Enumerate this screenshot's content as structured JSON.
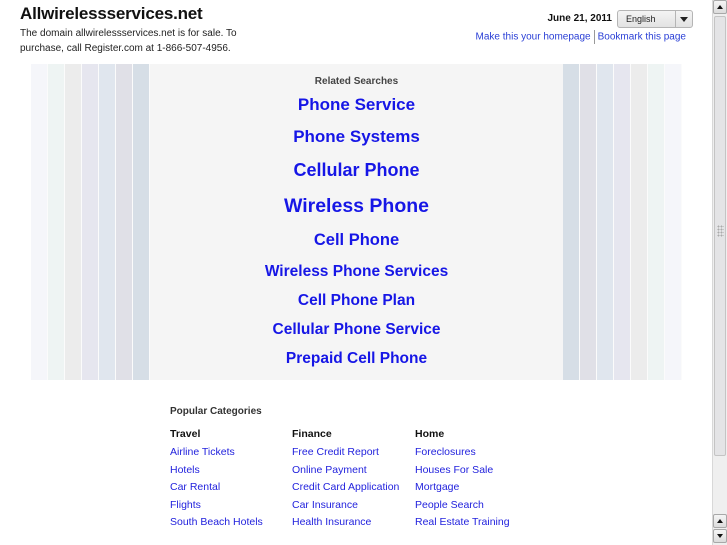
{
  "header": {
    "site_title": "Allwirelessservices.net",
    "sale_notice": "The domain allwirelessservices.net is for sale. To purchase, call Register.com at 1-866-507-4956.",
    "date": "June 21, 2011",
    "language_select": {
      "selected": "English"
    },
    "links": {
      "homepage": "Make this your homepage",
      "bookmark": "Bookmark this page"
    }
  },
  "colors": {
    "link": "#1616e6",
    "panel_bg": "#f5f5f5",
    "stripes_left": [
      "#f5f6fa",
      "#eef4f3",
      "#ececec",
      "#e6e6ef",
      "#e0e6ee",
      "#e0e0e7",
      "#d6dee6"
    ],
    "stripes_right": [
      "#d6dee6",
      "#e0e0e7",
      "#e0e6ee",
      "#e6e6ef",
      "#ececec",
      "#eef4f3",
      "#f5f6fa"
    ]
  },
  "related_searches": {
    "heading": "Related Searches",
    "items": [
      {
        "label": "Phone Service"
      },
      {
        "label": "Phone Systems"
      },
      {
        "label": "Cellular Phone"
      },
      {
        "label": "Wireless Phone"
      },
      {
        "label": "Cell Phone"
      },
      {
        "label": "Wireless Phone Services"
      },
      {
        "label": "Cell Phone Plan"
      },
      {
        "label": "Cellular Phone Service"
      },
      {
        "label": "Prepaid Cell Phone"
      }
    ]
  },
  "popular_categories": {
    "heading": "Popular Categories",
    "columns": [
      {
        "title": "Travel",
        "links": [
          "Airline Tickets",
          "Hotels",
          "Car Rental",
          "Flights",
          "South Beach Hotels"
        ]
      },
      {
        "title": "Finance",
        "links": [
          "Free Credit Report",
          "Online Payment",
          "Credit Card Application",
          "Car Insurance",
          "Health Insurance"
        ]
      },
      {
        "title": "Home",
        "links": [
          "Foreclosures",
          "Houses For Sale",
          "Mortgage",
          "People Search",
          "Real Estate Training"
        ]
      }
    ]
  }
}
